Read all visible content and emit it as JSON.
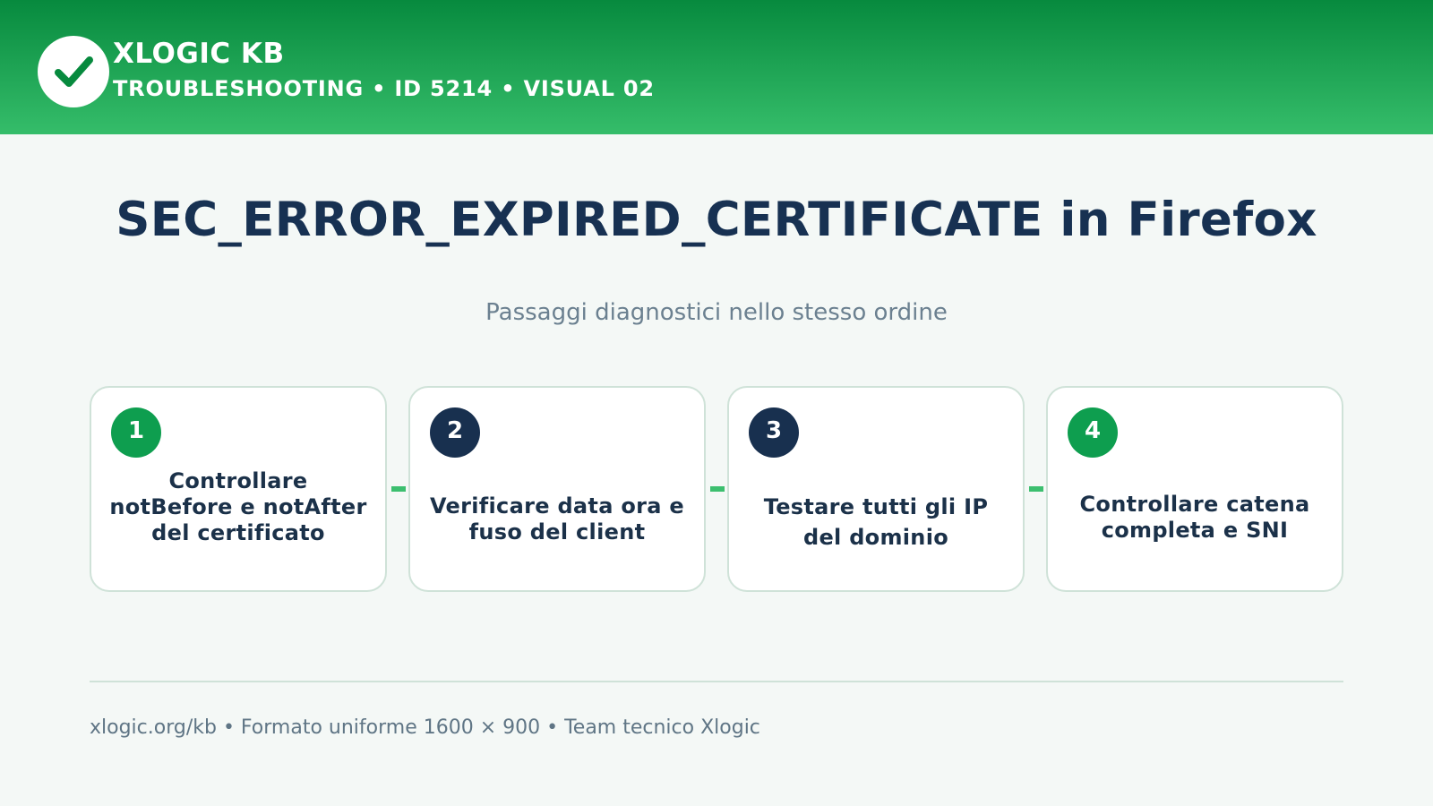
{
  "header": {
    "brand": "XLOGIC KB",
    "subtitle": "TROUBLESHOOTING • ID 5214 • VISUAL 02",
    "logo_icon": "check-circle-icon",
    "gradient_top": "#078a3e",
    "gradient_bottom": "#35bd6a"
  },
  "main": {
    "title": "SEC_ERROR_EXPIRED_CERTIFICATE in Firefox",
    "subtitle": "Passaggi diagnostici nello stesso ordine"
  },
  "steps": [
    {
      "number": "1",
      "text": "Controllare notBefore e notAfter del certificato",
      "badge_color": "#0e9e4f"
    },
    {
      "number": "2",
      "text": "Verificare data ora e fuso del client",
      "badge_color": "#18304f"
    },
    {
      "number": "3",
      "text": "Testare tutti gli IP del dominio",
      "badge_color": "#18304f"
    },
    {
      "number": "4",
      "text": "Controllare catena completa e SNI",
      "badge_color": "#0e9e4f"
    }
  ],
  "footer": {
    "text": "xlogic.org/kb • Formato uniforme 1600 × 900 • Team tecnico Xlogic"
  }
}
